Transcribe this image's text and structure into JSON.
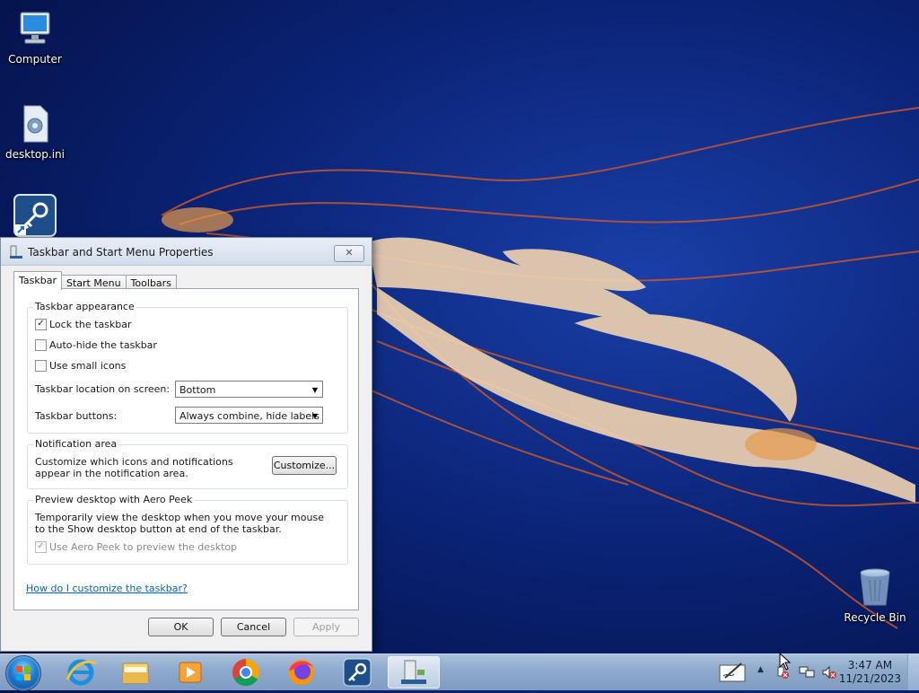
{
  "desktop": {
    "icons": [
      {
        "label": "Computer",
        "icon": "computer-icon"
      },
      {
        "label": "desktop.ini",
        "icon": "settings-file-icon"
      },
      {
        "label": "",
        "icon": "key-shortcut-icon"
      },
      {
        "label": "Recycle Bin",
        "icon": "recycle-bin-icon"
      }
    ]
  },
  "dialog": {
    "title": "Taskbar and Start Menu Properties",
    "close_label": "✕",
    "tabs": [
      {
        "label": "Taskbar",
        "active": true
      },
      {
        "label": "Start Menu",
        "active": false
      },
      {
        "label": "Toolbars",
        "active": false
      }
    ],
    "appearance": {
      "title": "Taskbar appearance",
      "lock": {
        "label": "Lock the taskbar",
        "checked": true
      },
      "autohide": {
        "label": "Auto-hide the taskbar",
        "checked": false
      },
      "small_icons": {
        "label": "Use small icons",
        "checked": false
      },
      "location_label": "Taskbar location on screen:",
      "location_value": "Bottom",
      "buttons_label": "Taskbar buttons:",
      "buttons_value": "Always combine, hide labels"
    },
    "notification": {
      "title": "Notification area",
      "text": "Customize which icons and notifications appear in the notification area.",
      "customize_label": "Customize..."
    },
    "peek": {
      "title": "Preview desktop with Aero Peek",
      "text": "Temporarily view the desktop when you move your mouse to the Show desktop button at end of the taskbar.",
      "checkbox_label": "Use Aero Peek to preview the desktop",
      "checked": true,
      "disabled": true
    },
    "help_link": "How do I customize the taskbar?",
    "ok_label": "OK",
    "cancel_label": "Cancel",
    "apply_label": "Apply"
  },
  "taskbar": {
    "pinned": [
      "internet-explorer-icon",
      "file-explorer-icon",
      "media-player-icon",
      "chrome-icon",
      "firefox-icon",
      "keepass-icon",
      "taskbar-properties-icon"
    ],
    "clock_time": "3:47 AM",
    "clock_date": "11/21/2023",
    "tray_arrow": "▲"
  },
  "colors": {
    "accent": "#0066cc",
    "desktop_bg": "#0b2478",
    "taskbar": "#8ea9cb"
  }
}
